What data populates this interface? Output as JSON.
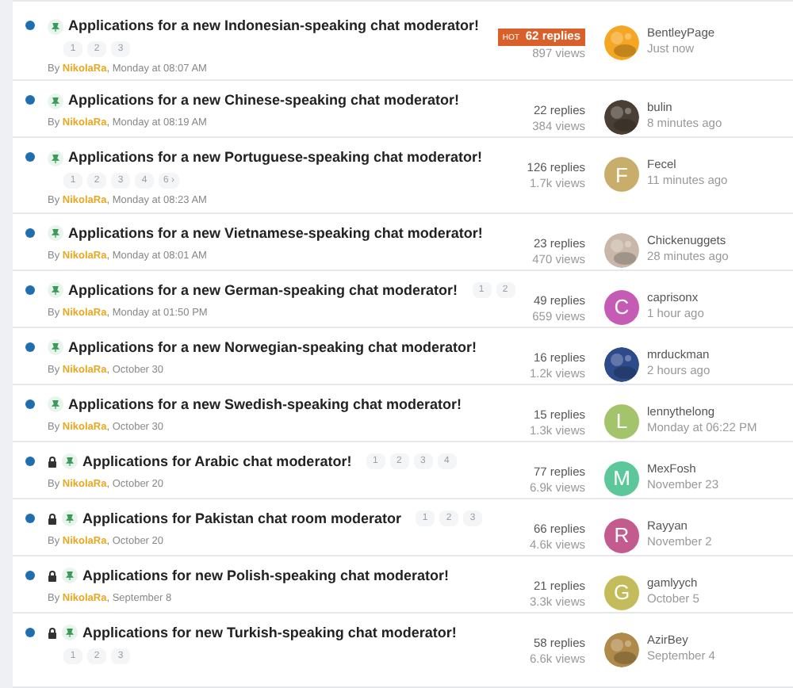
{
  "topics": [
    {
      "title": "Applications for a new Indonesian-speaking chat moderator!",
      "unread": true,
      "pinned": true,
      "locked": false,
      "kind": "stacked",
      "pages": [
        "1",
        "2",
        "3"
      ],
      "by": "By",
      "author": "NikolaRa",
      "date": ", Monday at 08:07 AM",
      "hot": true,
      "hot_label": "HOT",
      "replies": "62 replies",
      "views": "897 views",
      "last_user": "BentleyPage",
      "last_time": "Just now",
      "avatar": {
        "kind": "picture",
        "color": "#f5a623"
      }
    },
    {
      "title": "Applications for a new Chinese-speaking chat moderator!",
      "unread": true,
      "pinned": true,
      "locked": false,
      "kind": "stacked",
      "by": "By",
      "author": "NikolaRa",
      "date": ", Monday at 08:19 AM",
      "hot": false,
      "replies": "22 replies",
      "views": "384 views",
      "last_user": "bulin",
      "last_time": "8 minutes ago",
      "avatar": {
        "kind": "picture",
        "color": "#4a3f35"
      }
    },
    {
      "title": "Applications for a new Portuguese-speaking chat moderator!",
      "unread": true,
      "pinned": true,
      "locked": false,
      "kind": "stacked",
      "pages": [
        "1",
        "2",
        "3",
        "4",
        "6 ›"
      ],
      "by": "By",
      "author": "NikolaRa",
      "date": ", Monday at 08:23 AM",
      "hot": false,
      "replies": "126 replies",
      "views": "1.7k views",
      "last_user": "Fecel",
      "last_time": "11 minutes ago",
      "avatar": {
        "kind": "letter",
        "letter": "F",
        "color": "#c9ad6a"
      }
    },
    {
      "title": "Applications for a new Vietnamese-speaking chat moderator!",
      "unread": true,
      "pinned": true,
      "locked": false,
      "kind": "stacked",
      "by": "By",
      "author": "NikolaRa",
      "date": ", Monday at 08:01 AM",
      "hot": false,
      "replies": "23 replies",
      "views": "470 views",
      "last_user": "Chickenuggets",
      "last_time": "28 minutes ago",
      "avatar": {
        "kind": "picture",
        "color": "#c9b8aa"
      }
    },
    {
      "title": "Applications for a new German-speaking chat moderator!",
      "unread": true,
      "pinned": true,
      "locked": false,
      "kind": "inline",
      "pages": [
        "1",
        "2"
      ],
      "by": "By",
      "author": "NikolaRa",
      "date": ", Monday at 01:50 PM",
      "hot": false,
      "replies": "49 replies",
      "views": "659 views",
      "last_user": "caprisonx",
      "last_time": "1 hour ago",
      "avatar": {
        "kind": "letter",
        "letter": "C",
        "color": "#c45bb5"
      }
    },
    {
      "title": "Applications for a new Norwegian-speaking chat moderator!",
      "unread": true,
      "pinned": true,
      "locked": false,
      "kind": "stacked",
      "by": "By",
      "author": "NikolaRa",
      "date": ", October 30",
      "hot": false,
      "replies": "16 replies",
      "views": "1.2k views",
      "last_user": "mrduckman",
      "last_time": "2 hours ago",
      "avatar": {
        "kind": "picture",
        "color": "#2d4a8a"
      }
    },
    {
      "title": "Applications for a new Swedish-speaking chat moderator!",
      "unread": true,
      "pinned": true,
      "locked": false,
      "kind": "stacked",
      "by": "By",
      "author": "NikolaRa",
      "date": ", October 30",
      "hot": false,
      "replies": "15 replies",
      "views": "1.3k views",
      "last_user": "lennythelong",
      "last_time": "Monday at 06:22 PM",
      "avatar": {
        "kind": "letter",
        "letter": "L",
        "color": "#a3c46a"
      }
    },
    {
      "title": "Applications for Arabic chat moderator!",
      "unread": true,
      "pinned": true,
      "locked": true,
      "kind": "inline",
      "pages": [
        "1",
        "2",
        "3",
        "4"
      ],
      "by": "By",
      "author": "NikolaRa",
      "date": ", October 20",
      "hot": false,
      "replies": "77 replies",
      "views": "6.9k views",
      "last_user": "MexFosh",
      "last_time": "November 23",
      "avatar": {
        "kind": "letter",
        "letter": "M",
        "color": "#5cc79a"
      }
    },
    {
      "title": "Applications for Pakistan chat room moderator",
      "unread": true,
      "pinned": true,
      "locked": true,
      "kind": "inline",
      "pages": [
        "1",
        "2",
        "3"
      ],
      "by": "By",
      "author": "NikolaRa",
      "date": ", October 20",
      "hot": false,
      "replies": "66 replies",
      "views": "4.6k views",
      "last_user": "Rayyan",
      "last_time": "November 2",
      "avatar": {
        "kind": "letter",
        "letter": "R",
        "color": "#c45b8e"
      }
    },
    {
      "title": "Applications for new Polish-speaking chat moderator!",
      "unread": true,
      "pinned": true,
      "locked": true,
      "kind": "stacked",
      "by": "By",
      "author": "NikolaRa",
      "date": ", September 8",
      "hot": false,
      "replies": "21 replies",
      "views": "3.3k views",
      "last_user": "gamlyych",
      "last_time": "October 5",
      "avatar": {
        "kind": "letter",
        "letter": "G",
        "color": "#c4bb5b"
      }
    },
    {
      "title": "Applications for new Turkish-speaking chat moderator!",
      "unread": true,
      "pinned": true,
      "locked": true,
      "kind": "stacked",
      "pages": [
        "1",
        "2",
        "3"
      ],
      "hot": false,
      "replies": "58 replies",
      "views": "6.6k views",
      "last_user": "AzirBey",
      "last_time": "September 4",
      "avatar": {
        "kind": "picture",
        "color": "#b08a4a"
      }
    }
  ]
}
